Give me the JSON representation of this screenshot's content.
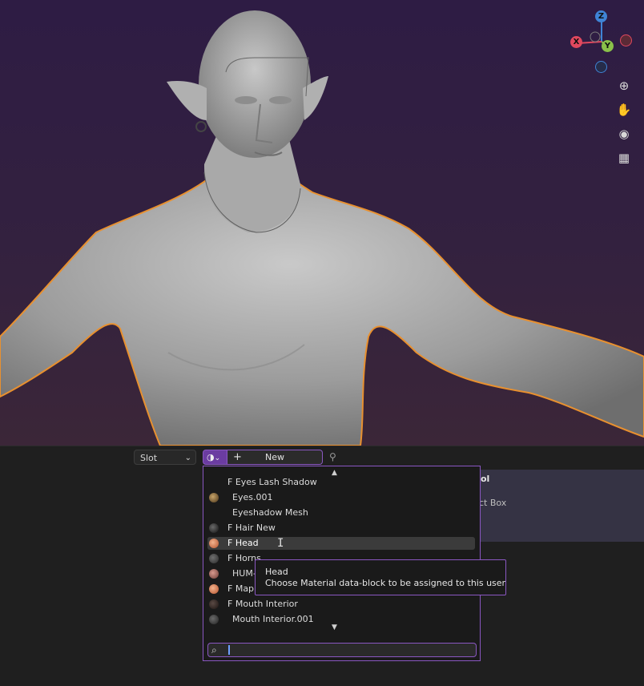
{
  "toolbar": {
    "slot_label": "Slot",
    "new_label": "New",
    "plus": "+"
  },
  "gizmo": {
    "z": "Z",
    "x": "X",
    "y": "Y",
    "colors": {
      "x": "#e0485e",
      "y": "#8ac14a",
      "z": "#3f84d6"
    }
  },
  "nav_icons": [
    "zoom-icon",
    "pan-hand-icon",
    "camera-icon",
    "perspective-grid-icon"
  ],
  "background_panel": {
    "label_1": "ol",
    "label_2": "ct Box"
  },
  "material_list": {
    "items": [
      {
        "label": "F Eyes Lash Shadow",
        "icon": "none"
      },
      {
        "label": "Eyes.001",
        "icon": "eye-material"
      },
      {
        "label": "Eyeshadow Mesh",
        "icon": "none"
      },
      {
        "label": "F Hair New",
        "icon": "hair-material"
      },
      {
        "label": "F Head",
        "icon": "skin-material",
        "active": true
      },
      {
        "label": "F Horns",
        "icon": "dark-material"
      },
      {
        "label": "HUM-",
        "icon": "skin-material"
      },
      {
        "label": "F Map",
        "icon": "skin-material"
      },
      {
        "label": "F Mouth Interior",
        "icon": "dark-material"
      },
      {
        "label": "Mouth Interior.001",
        "icon": "dark-material"
      }
    ],
    "search_placeholder": ""
  },
  "tooltip": {
    "title": "Head",
    "description": "Choose Material data-block to be assigned to this user"
  },
  "colors": {
    "accent": "#8a57c2",
    "selection_outline": "#e8902f"
  }
}
